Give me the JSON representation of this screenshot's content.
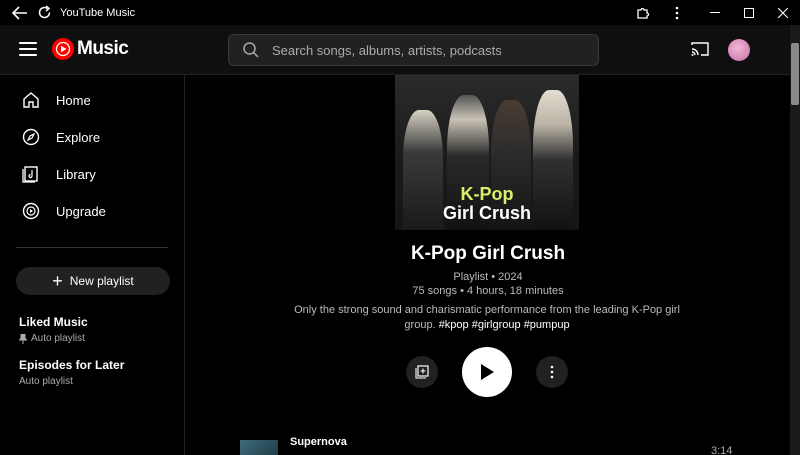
{
  "app": {
    "window_title": "YouTube Music",
    "logo_text": "Music"
  },
  "search": {
    "placeholder": "Search songs, albums, artists, podcasts"
  },
  "sidebar": {
    "nav": [
      {
        "label": "Home",
        "icon": "home-icon"
      },
      {
        "label": "Explore",
        "icon": "compass-icon"
      },
      {
        "label": "Library",
        "icon": "library-icon"
      },
      {
        "label": "Upgrade",
        "icon": "upgrade-icon"
      }
    ],
    "new_playlist_label": "New playlist",
    "playlists": [
      {
        "title": "Liked Music",
        "subtitle": "Auto playlist",
        "pinned": true
      },
      {
        "title": "Episodes for Later",
        "subtitle": "Auto playlist",
        "pinned": false
      }
    ]
  },
  "playlist": {
    "cover_line1": "K-Pop",
    "cover_line2": "Girl Crush",
    "title": "K-Pop Girl Crush",
    "meta_type_year": "Playlist • 2024",
    "meta_counts": "75 songs • 4 hours, 18 minutes",
    "description": "Only the strong sound and charismatic performance from the leading K-Pop girl group.",
    "hashtags": "#kpop #girlgroup #pumpup"
  },
  "tracks": [
    {
      "title": "Supernova",
      "duration": "3:14"
    }
  ],
  "colors": {
    "brand_red": "#ff0000",
    "cover_accent": "#d9f06a",
    "background": "#000000"
  }
}
